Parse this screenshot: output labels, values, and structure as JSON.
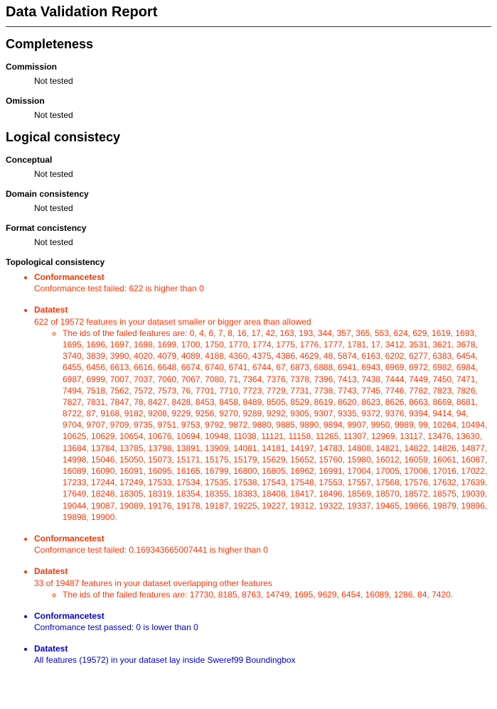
{
  "title": "Data Validation Report",
  "sections": {
    "completeness": {
      "heading": "Completeness",
      "commission": {
        "label": "Commission",
        "value": "Not tested"
      },
      "omission": {
        "label": "Omission",
        "value": "Not tested"
      }
    },
    "logical": {
      "heading": "Logical consistecy",
      "conceptual": {
        "label": "Conceptual",
        "value": "Not tested"
      },
      "domain": {
        "label": "Domain consistency",
        "value": "Not tested"
      },
      "format": {
        "label": "Format concistency",
        "value": "Not tested"
      },
      "topological": {
        "label": "Topological consistency"
      }
    }
  },
  "topological_tests": [
    {
      "status": "fail",
      "label": "Conformancetest",
      "body": "Conformance test failed: 622 is higher than 0"
    },
    {
      "status": "fail",
      "label": "Datatest",
      "body": "622 of 19572 features in your dataset smaller or bigger area than allowed",
      "detail": "The ids of the failed features are: 0, 4, 6, 7, 8, 16, 17, 42, 163, 193, 344, 357, 365, 553, 624, 629, 1619, 1693, 1695, 1696, 1697, 1698, 1699, 1700, 1750, 1770, 1774, 1775, 1776, 1777, 1781, 17, 3412, 3531, 3621, 3678, 3740, 3839, 3990, 4020, 4079, 4089, 4188, 4360, 4375, 4386, 4629, 48, 5874, 6163, 6202, 6277, 6383, 6454, 6455, 6456, 6613, 6616, 6648, 6674, 6740, 6741, 6744, 67, 6873, 6888, 6941, 6943, 6969, 6972, 6982, 6984, 6987, 6999, 7007, 7037, 7060, 7067, 7080, 71, 7364, 7376, 7378, 7396, 7413, 7438, 7444, 7449, 7450, 7471, 7494, 7518, 7562, 7572, 7573, 76, 7701, 7710, 7723, 7729, 7731, 7738, 7743, 7745, 7746, 7782, 7823, 7826, 7827, 7831, 7847, 78, 8427, 8428, 8453, 8458, 8489, 8505, 8529, 8619, 8620, 8623, 8626, 8663, 8669, 8681, 8722, 87, 9168, 9182, 9208, 9229, 9256, 9270, 9289, 9292, 9305, 9307, 9335, 9372, 9376, 9394, 9414, 94, 9704, 9707, 9709, 9735, 9751, 9753, 9792, 9872, 9880, 9885, 9890, 9894, 9907, 9950, 9989, 99, 10264, 10494, 10625, 10629, 10654, 10676, 10694, 10948, 11038, 11121, 11158, 11265, 11307, 12969, 13117, 13476, 13630, 13684, 13784, 13785, 13798, 13891, 13909, 14081, 14181, 14197, 14783, 14808, 14821, 14822, 14826, 14877, 14998, 15046, 15050, 15073, 15171, 15175, 15179, 15629, 15652, 15760, 15980, 16012, 16059, 16061, 16087, 16089, 16090, 16091, 16095, 16165, 16799, 16800, 16805, 16962, 16991, 17004, 17005, 17006, 17016, 17022, 17233, 17244, 17249, 17533, 17534, 17535, 17538, 17543, 17548, 17553, 17557, 17568, 17576, 17632, 17639, 17649, 18248, 18305, 18319, 18354, 18355, 18383, 18408, 18417, 18496, 18569, 18570, 18572, 18575, 19039, 19044, 19087, 19089, 19176, 19178, 19187, 19225, 19227, 19312, 19322, 19337, 19465, 19866, 19879, 19896, 19898, 19900."
    },
    {
      "status": "fail",
      "label": "Conformancetest",
      "body": "Conformance test failed: 0.169343665007441 is higher than 0"
    },
    {
      "status": "fail",
      "label": "Datatest",
      "body": "33 of 19487 features in your dataset overlapping other features",
      "detail": "The ids of the failed features are: 17730, 8185, 8763, 14749, 1695, 9629, 6454, 16089, 1286, 84, 7420."
    },
    {
      "status": "pass",
      "label": "Conformancetest",
      "body": "Confromance test passed: 0 is lower than 0"
    },
    {
      "status": "pass",
      "label": "Datatest",
      "body": "All features (19572) in your dataset lay inside Sweref99 Boundingbox"
    }
  ]
}
